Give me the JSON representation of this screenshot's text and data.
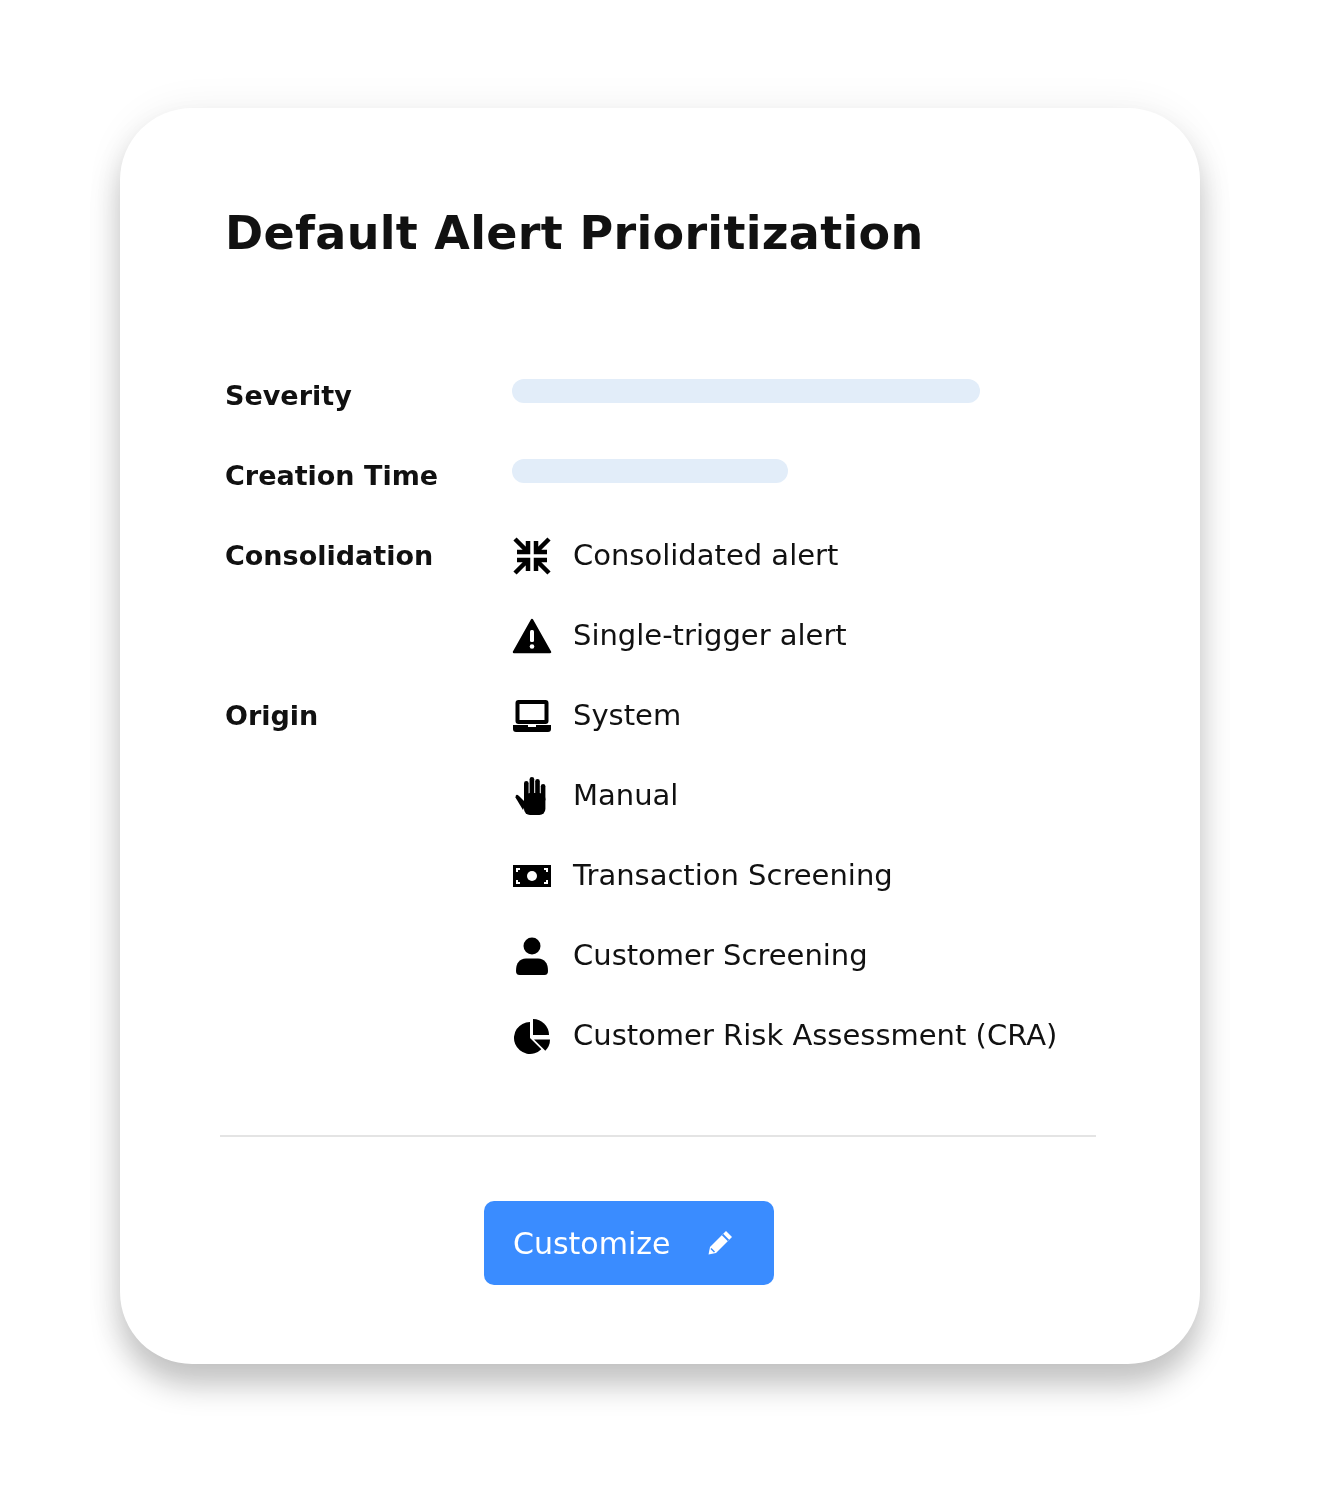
{
  "card": {
    "title": "Default Alert Prioritization",
    "rows": [
      {
        "label": "Severity",
        "kind": "bar"
      },
      {
        "label": "Creation Time",
        "kind": "bar"
      },
      {
        "label": "Consolidation",
        "kind": "options",
        "options": [
          "Consolidated alert",
          "Single-trigger alert"
        ]
      },
      {
        "label": "Origin",
        "kind": "options",
        "options": [
          "System",
          "Manual",
          "Transaction Screening",
          "Customer Screening",
          "Customer Risk Assessment (CRA)"
        ]
      }
    ],
    "button": {
      "label": "Customize"
    }
  }
}
